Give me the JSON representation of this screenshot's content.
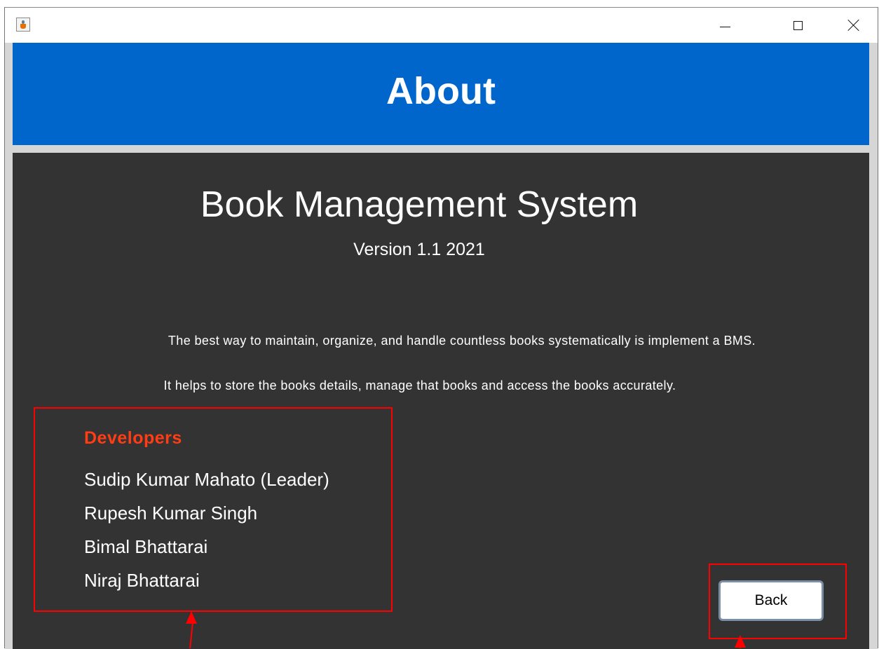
{
  "window": {
    "title": "",
    "controls": {
      "minimize": "minimize-icon",
      "maximize": "maximize-icon",
      "close": "close-icon"
    }
  },
  "header": {
    "title": "About",
    "background_color": "#0066cc"
  },
  "app": {
    "name": "Book Management System",
    "version": "Version 1.1 2021",
    "description_1": "The best way to maintain, organize, and handle countless books systematically is implement a BMS.",
    "description_2": "It helps to store the books details, manage that books and access the books accurately."
  },
  "developers": {
    "heading": "Developers",
    "heading_color": "#ff3c14",
    "names": [
      "Sudip Kumar Mahato (Leader)",
      "Rupesh Kumar Singh",
      "Bimal Bhattarai",
      "Niraj Bhattarai"
    ]
  },
  "actions": {
    "back_label": "Back"
  },
  "annotations": {
    "highlight_color": "#ff0000"
  }
}
